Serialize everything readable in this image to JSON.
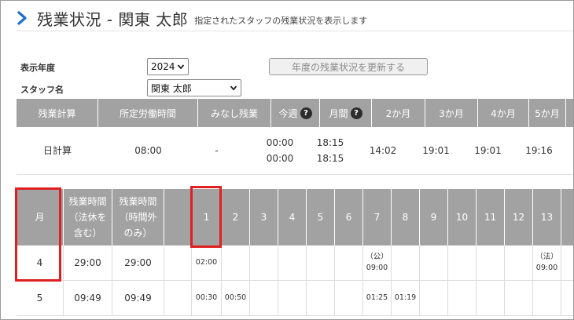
{
  "header": {
    "title": "残業状況 - 関東 太郎",
    "description": "指定されたスタッフの残業状況を表示します"
  },
  "form": {
    "year_label": "表示年度",
    "year_value": "2024",
    "staff_label": "スタッフ名",
    "staff_value": "関東 太郎",
    "update_button": "年度の残業状況を更新する"
  },
  "summary": {
    "headers": [
      "残業計算",
      "所定労働時間",
      "みなし残業",
      "今週",
      "月間",
      "2か月",
      "3か月",
      "4か月",
      "5か月"
    ],
    "row": {
      "calc": "日計算",
      "scheduled": "08:00",
      "deemed": "-",
      "week_line1": "00:00",
      "week_line2": "00:00",
      "month_line1": "18:15",
      "month_line2": "18:15",
      "m2": "14:02",
      "m3": "19:01",
      "m4": "19:01",
      "m5": "19:16"
    }
  },
  "monthly": {
    "col_month": "月",
    "col_overtime_incl_line1": "残業時間",
    "col_overtime_incl_line2": "（法休を",
    "col_overtime_incl_line3": "含む）",
    "col_overtime_only_line1": "残業時間",
    "col_overtime_only_line2": "（時間外",
    "col_overtime_only_line3": "のみ）",
    "days": [
      "1",
      "2",
      "3",
      "4",
      "5",
      "6",
      "7",
      "8",
      "9",
      "10",
      "11",
      "12",
      "13"
    ],
    "rows": [
      {
        "month": "4",
        "incl": "29:00",
        "only": "29:00",
        "d1": "02:00",
        "d7_top": "（公）",
        "d7_bot": "09:00",
        "d13_top": "（法）",
        "d13_bot": "09:00"
      },
      {
        "month": "5",
        "incl": "09:49",
        "only": "09:49",
        "d1": "00:30",
        "d2": "00:50",
        "d7": "01:25",
        "d8": "01:19"
      }
    ]
  },
  "colors": {
    "header_gray": "#a2a2a2",
    "chevron_blue": "#1c6fd1",
    "highlight_red": "#e02020"
  }
}
